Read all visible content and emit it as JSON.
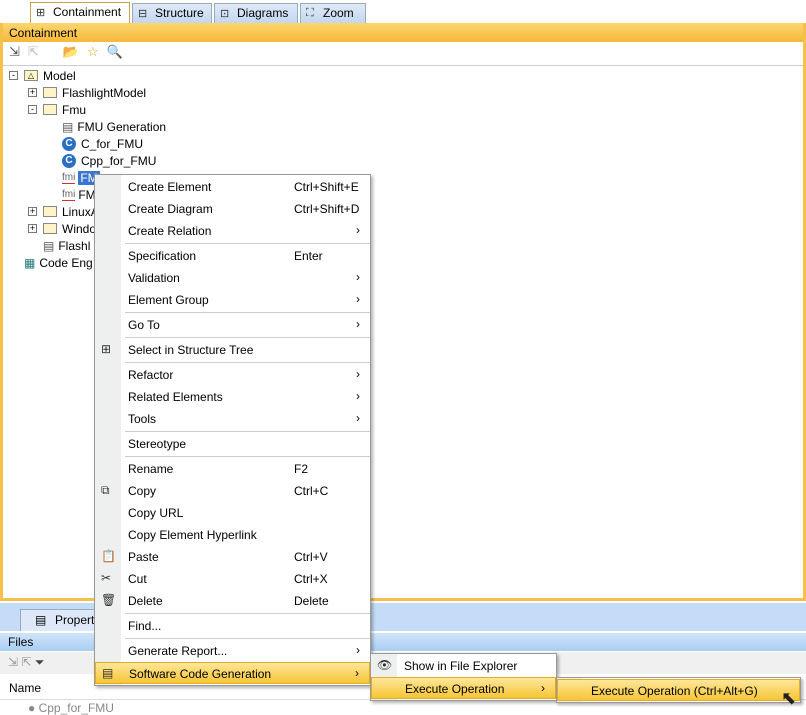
{
  "tabs": [
    "Containment",
    "Structure",
    "Diagrams",
    "Zoom"
  ],
  "panel_title": "Containment",
  "tree": [
    {
      "label": "Model",
      "level": 0,
      "type": "model",
      "expander": "-"
    },
    {
      "label": "FlashlightModel",
      "level": 1,
      "type": "folder",
      "expander": "+"
    },
    {
      "label": "Fmu",
      "level": 1,
      "type": "folder",
      "expander": "-"
    },
    {
      "label": "FMU Generation",
      "level": 2,
      "type": "doc"
    },
    {
      "label": "C_for_FMU",
      "level": 2,
      "type": "c"
    },
    {
      "label": "Cpp_for_FMU",
      "level": 2,
      "type": "c"
    },
    {
      "label": "FM",
      "level": 2,
      "type": "fmi",
      "selected": true
    },
    {
      "label": "FM",
      "level": 2,
      "type": "fmi"
    },
    {
      "label": "LinuxA",
      "level": 1,
      "type": "folder",
      "expander": "+"
    },
    {
      "label": "Windo",
      "level": 1,
      "type": "folder",
      "expander": "+"
    },
    {
      "label": "Flashl",
      "level": 1,
      "type": "doc"
    },
    {
      "label": "Code Eng",
      "level": 0,
      "type": "db"
    }
  ],
  "context_menu": [
    {
      "label": "Create Element",
      "shortcut": "Ctrl+Shift+E"
    },
    {
      "label": "Create Diagram",
      "shortcut": "Ctrl+Shift+D"
    },
    {
      "label": "Create Relation",
      "submenu": true
    },
    {
      "sep": true
    },
    {
      "label": "Specification",
      "shortcut": "Enter"
    },
    {
      "label": "Validation",
      "submenu": true
    },
    {
      "label": "Element Group",
      "submenu": true
    },
    {
      "sep": true
    },
    {
      "label": "Go To",
      "submenu": true
    },
    {
      "sep": true
    },
    {
      "label": "Select in Structure Tree",
      "icon": "⊞"
    },
    {
      "sep": true
    },
    {
      "label": "Refactor",
      "submenu": true
    },
    {
      "label": "Related Elements",
      "submenu": true
    },
    {
      "label": "Tools",
      "submenu": true
    },
    {
      "sep": true
    },
    {
      "label": "Stereotype"
    },
    {
      "sep": true
    },
    {
      "label": "Rename",
      "shortcut": "F2"
    },
    {
      "label": "Copy",
      "shortcut": "Ctrl+C",
      "icon": "⧉"
    },
    {
      "label": "Copy URL"
    },
    {
      "label": "Copy Element Hyperlink"
    },
    {
      "label": "Paste",
      "shortcut": "Ctrl+V",
      "icon": "📋"
    },
    {
      "label": "Cut",
      "shortcut": "Ctrl+X",
      "icon": "✂"
    },
    {
      "label": "Delete",
      "shortcut": "Delete",
      "icon": "🗑"
    },
    {
      "sep": true
    },
    {
      "label": "Find..."
    },
    {
      "sep": true
    },
    {
      "label": "Generate Report...",
      "submenu": true
    },
    {
      "label": "Software Code Generation",
      "submenu": true,
      "highlighted": true,
      "icon": "▤"
    }
  ],
  "submenu1": [
    {
      "label": "Show in File Explorer",
      "icon": "👁"
    },
    {
      "label": "Execute Operation",
      "submenu": true,
      "highlighted": true
    }
  ],
  "submenu2": [
    {
      "label": "Execute Operation (Ctrl+Alt+G)",
      "highlighted": true
    }
  ],
  "bottom": {
    "tab": "Propert",
    "files_title": "Files",
    "column": "Name",
    "row": "Cpp_for_FMU"
  }
}
